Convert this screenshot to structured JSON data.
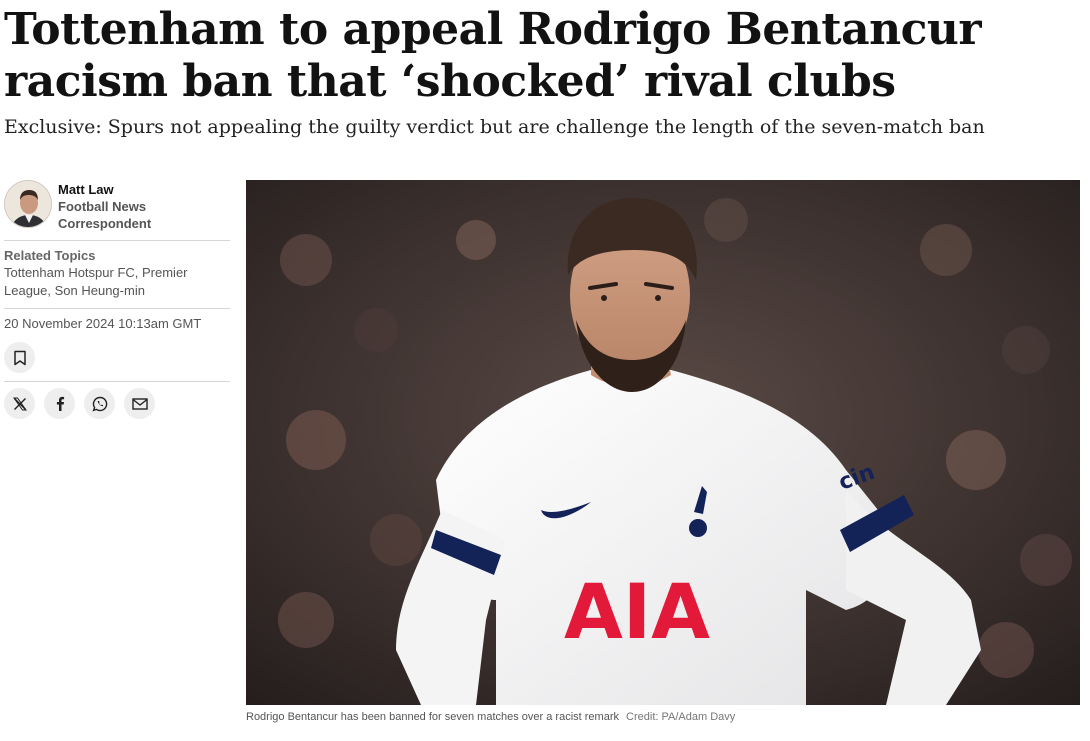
{
  "article": {
    "headline": "Tottenham to appeal Rodrigo Bentancur racism ban that ‘shocked’ rival clubs",
    "standfirst": "Exclusive: Spurs not appealing the guilty verdict but are challenge the length of the seven-match ban"
  },
  "author": {
    "name": "Matt Law",
    "role": "Football News Correspondent"
  },
  "topics": {
    "title": "Related Topics",
    "list": "Tottenham Hotspur FC, Premier League, Son Heung-min"
  },
  "published": "20 November 2024 10:13am GMT",
  "actions": {
    "bookmark": "bookmark-icon",
    "share": [
      "x-icon",
      "facebook-icon",
      "whatsapp-icon",
      "email-icon"
    ]
  },
  "image": {
    "caption": "Rodrigo Bentancur has been banned for seven matches over a racist remark",
    "credit": "Credit: PA/Adam Davy",
    "shirt_sponsor": "AIA",
    "sleeve_sponsor": "cin"
  }
}
